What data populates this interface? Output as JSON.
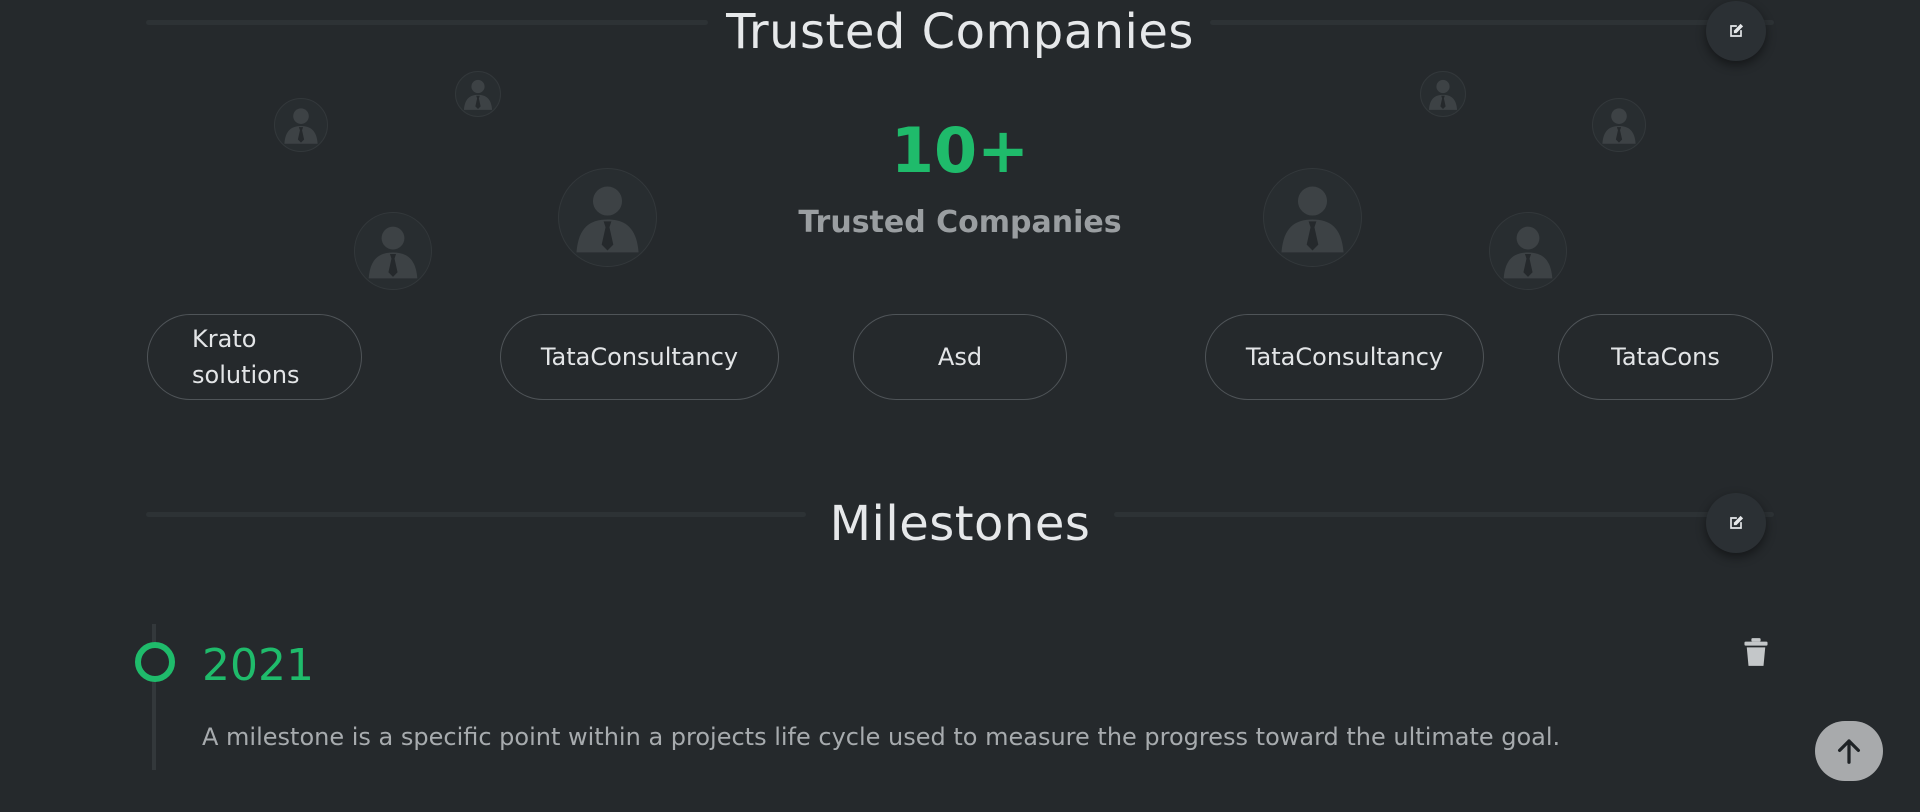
{
  "trusted": {
    "title": "Trusted Companies",
    "stat_number": "10+",
    "stat_label": "Trusted Companies",
    "companies": [
      "Krato solutions",
      "TataConsultancy",
      "Asd",
      "TataConsultancy",
      "TataCons"
    ]
  },
  "milestones": {
    "title": "Milestones",
    "items": [
      {
        "year": "2021",
        "description": "A milestone is a specific point within a projects life cycle used to measure the progress toward the ultimate goal."
      }
    ]
  },
  "icons": {
    "edit": "edit-icon",
    "avatar": "user-avatar-icon",
    "delete": "trash-icon",
    "scroll_top": "arrow-up-icon"
  },
  "colors": {
    "background": "#25292c",
    "accent": "#1fbb6b",
    "title_text": "#e6e8ea",
    "muted_text": "#9a9ea1",
    "pill_border": "#4f5458"
  }
}
